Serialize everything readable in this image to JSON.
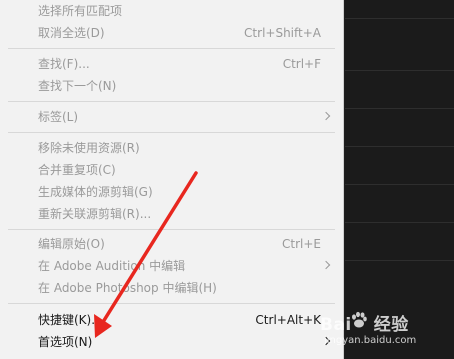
{
  "menu": {
    "items": [
      {
        "label": "选择所有匹配项",
        "shortcut": "",
        "enabled": false,
        "submenu": false
      },
      {
        "label": "取消全选(D)",
        "shortcut": "Ctrl+Shift+A",
        "enabled": false,
        "submenu": false
      },
      {
        "label": "查找(F)...",
        "shortcut": "Ctrl+F",
        "enabled": false,
        "submenu": false
      },
      {
        "label": "查找下一个(N)",
        "shortcut": "",
        "enabled": false,
        "submenu": false
      },
      {
        "label": "标签(L)",
        "shortcut": "",
        "enabled": false,
        "submenu": true
      },
      {
        "label": "移除未使用资源(R)",
        "shortcut": "",
        "enabled": false,
        "submenu": false
      },
      {
        "label": "合并重复项(C)",
        "shortcut": "",
        "enabled": false,
        "submenu": false
      },
      {
        "label": "生成媒体的源剪辑(G)",
        "shortcut": "",
        "enabled": false,
        "submenu": false
      },
      {
        "label": "重新关联源剪辑(R)...",
        "shortcut": "",
        "enabled": false,
        "submenu": false
      },
      {
        "label": "编辑原始(O)",
        "shortcut": "Ctrl+E",
        "enabled": false,
        "submenu": false
      },
      {
        "label": "在 Adobe Audition 中编辑",
        "shortcut": "",
        "enabled": false,
        "submenu": true
      },
      {
        "label": "在 Adobe Photoshop 中编辑(H)",
        "shortcut": "",
        "enabled": false,
        "submenu": false
      },
      {
        "label": "快捷键(K)...",
        "shortcut": "Ctrl+Alt+K",
        "enabled": true,
        "submenu": false
      },
      {
        "label": "首选项(N)",
        "shortcut": "",
        "enabled": true,
        "submenu": true
      }
    ]
  },
  "watermark": {
    "brand_left": "Bai",
    "brand_right": "经验",
    "site": "jingyan.baidu.com"
  },
  "colors": {
    "menu_bg": "#f2f2f2",
    "disabled_text": "#9a9a9a",
    "enabled_text": "#1a1a1a",
    "arrow": "#e8271f",
    "app_bg": "#1e1e1e"
  }
}
